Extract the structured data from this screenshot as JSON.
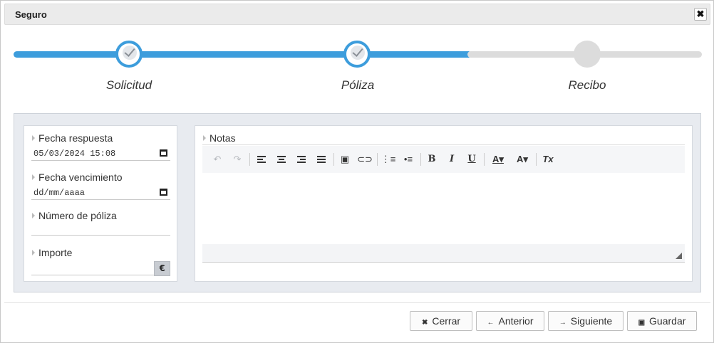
{
  "dialog": {
    "title": "Seguro",
    "close_icon": "✖"
  },
  "stepper": {
    "steps": [
      {
        "label": "Solicitud",
        "state": "done"
      },
      {
        "label": "Póliza",
        "state": "done"
      },
      {
        "label": "Recibo",
        "state": "pending"
      }
    ],
    "progress": 0.66,
    "accent": "#3d9ddc"
  },
  "form": {
    "fecha_respuesta": {
      "label": "Fecha respuesta",
      "value": "05/03/2024 15:08"
    },
    "fecha_vencimiento": {
      "label": "Fecha vencimiento",
      "value": "dd/mm/aaaa"
    },
    "numero_poliza": {
      "label": "Número de póliza",
      "value": ""
    },
    "importe": {
      "label": "Importe",
      "value": "",
      "currency": "€"
    }
  },
  "notes": {
    "label": "Notas",
    "toolbar": [
      "undo-icon",
      "redo-icon",
      "align-left-icon",
      "align-center-icon",
      "align-right-icon",
      "align-justify-icon",
      "image-icon",
      "link-icon",
      "ordered-list-icon",
      "bullet-list-icon",
      "bold-icon",
      "italic-icon",
      "underline-icon",
      "text-color-icon",
      "background-color-icon",
      "clear-format-icon"
    ],
    "glyphs": {
      "bold": "B",
      "italic": "I",
      "underline": "U",
      "text_color": "A▾",
      "bg_color": "A▾",
      "clear": "Tx"
    }
  },
  "buttons": {
    "cerrar": {
      "icon": "✖",
      "label": "Cerrar"
    },
    "anterior": {
      "icon": "←",
      "label": "Anterior"
    },
    "siguiente": {
      "icon": "→",
      "label": "Siguiente"
    },
    "guardar": {
      "icon": "▣",
      "label": "Guardar"
    }
  }
}
